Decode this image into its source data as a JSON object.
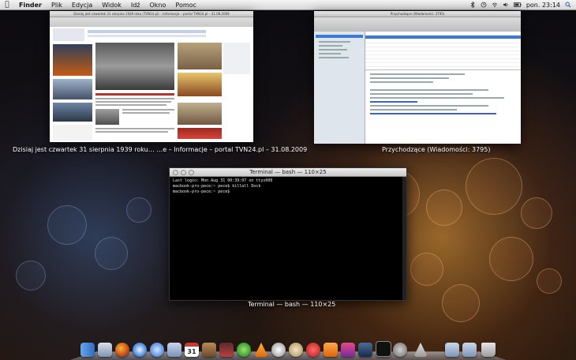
{
  "menubar": {
    "apple": "",
    "app": "Finder",
    "items": [
      "Plik",
      "Edycja",
      "Widok",
      "Idź",
      "Okno",
      "Pomoc"
    ],
    "clock": "pon. 23:14"
  },
  "windows": {
    "browser": {
      "title_bar": "Dzisiaj jest czwartek 31 sierpnia 1939 roku (TVN24.pl) – Informacje – portal TVN24.pl – 31.08.2009",
      "caption": "Dzisiaj jest czwartek 31 sierpnia 1939 roku… …e – Informacje – portal TVN24.pl – 31.08.2009"
    },
    "mail": {
      "title_bar": "Przychodzące (Wiadomości: 3795)",
      "caption": "Przychodzące (Wiadomości: 3795)"
    },
    "terminal": {
      "title_bar": "Terminal — bash — 110×25",
      "caption": "Terminal — bash — 110×25",
      "lines": [
        "Last login: Mon Aug 31 00:39:07 on ttys000",
        "macbook-pro-pece:~ pece$ killall Dock",
        "macbook-pro-pece:~ pece$ "
      ]
    }
  },
  "dock": {
    "icons": [
      "finder-icon",
      "preview-icon",
      "firefox-icon",
      "safari-icon",
      "itunes-icon",
      "mail-icon",
      "ical-icon",
      "address-book-icon",
      "photo-booth-icon",
      "utorrent-icon",
      "vlc-icon",
      "adium-icon",
      "chess-icon",
      "lastfm-icon",
      "rss-icon",
      "iphoto-icon",
      "photoshop-icon",
      "terminal-icon",
      "system-preferences-icon",
      "app-store-icon",
      "downloads-folder-icon",
      "documents-folder-icon",
      "trash-icon"
    ],
    "calendar_day": "31"
  },
  "colors": {
    "menubar": "#e2e2e2",
    "accent_selection": "#3d7ad6",
    "terminal_bg": "#000000"
  }
}
